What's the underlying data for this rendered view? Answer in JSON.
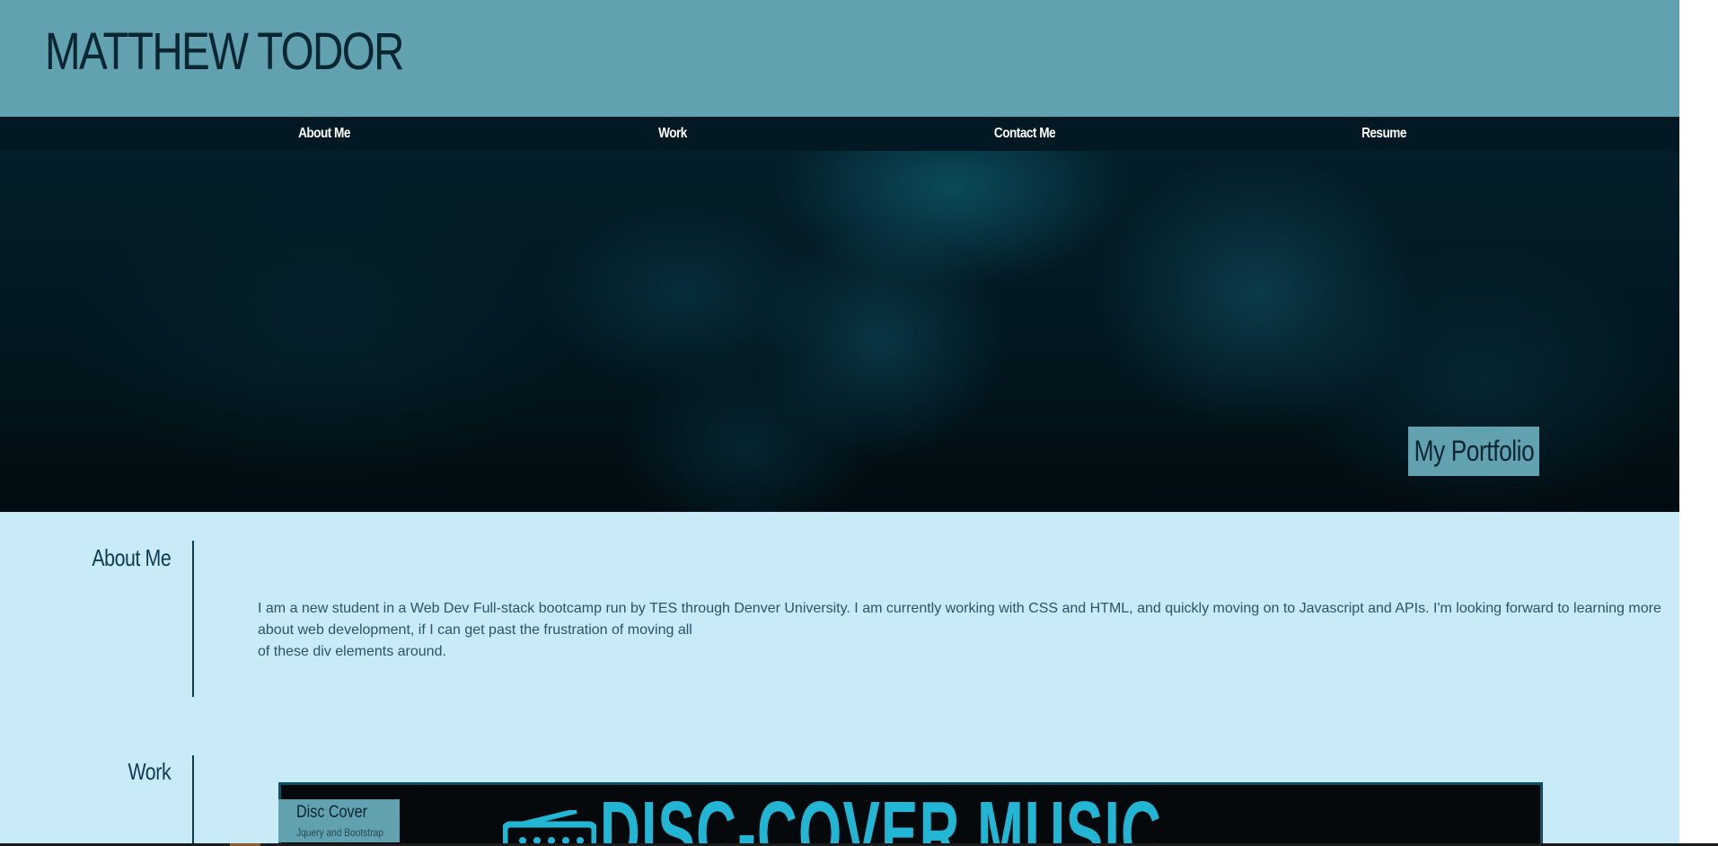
{
  "site": {
    "title": "MATTHEW TODOR"
  },
  "nav": {
    "items": [
      "About Me",
      "Work",
      "Contact Me",
      "Resume"
    ]
  },
  "hero": {
    "badge": "My Portfolio"
  },
  "about": {
    "title": "About Me",
    "text_line1": "I am a new student in a Web Dev Full-stack bootcamp run by TES through Denver University. I am currently working with CSS and HTML, and quickly moving on to Javascript and APIs. I'm looking forward to learning more about web development, if I can get past the frustration of moving all",
    "text_line2": "of these div elements around."
  },
  "work": {
    "title": "Work",
    "projects": [
      {
        "name": "Disc Cover",
        "tech": "Jquery and Bootstrap",
        "banner_text": "DISC-COVER MUSIC",
        "icon": "radio-icon"
      }
    ]
  },
  "colors": {
    "header": "#62a1b0",
    "nav": "#021923",
    "page_background": "#c9eaf7",
    "text_dark": "#0d3b52",
    "banner_accent": "#22b6d4"
  }
}
